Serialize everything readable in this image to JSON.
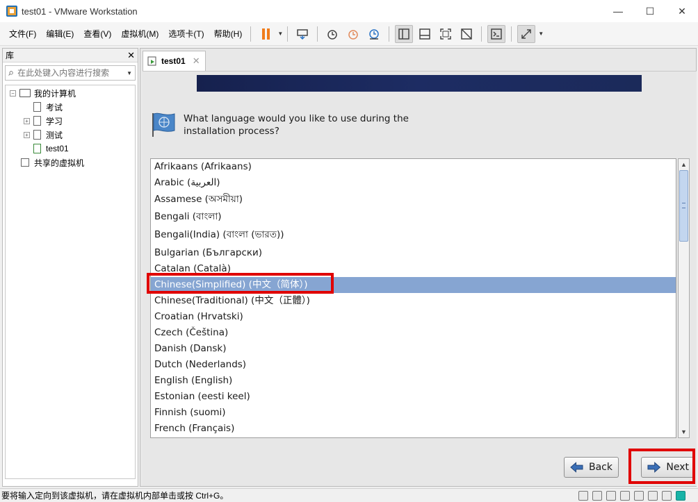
{
  "window": {
    "title": "test01 - VMware Workstation",
    "minimize": "—",
    "maximize": "☐",
    "close": "✕"
  },
  "menu": {
    "items": [
      "文件(F)",
      "编辑(E)",
      "查看(V)",
      "虚拟机(M)",
      "选项卡(T)",
      "帮助(H)"
    ]
  },
  "library": {
    "title": "库",
    "close": "✕",
    "search_placeholder": "在此处键入内容进行搜索",
    "tree": {
      "root": "我的计算机",
      "items": [
        "考试",
        "学习",
        "测试",
        "test01"
      ],
      "shared": "共享的虚拟机"
    }
  },
  "tab": {
    "title": "test01",
    "close": "✕"
  },
  "installer": {
    "question_line1": "What language would you like to use during the",
    "question_line2": "installation process?",
    "languages": [
      "Afrikaans (Afrikaans)",
      "Arabic (العربية)",
      "Assamese (অসমীয়া)",
      "Bengali (বাংলা)",
      "Bengali(India) (বাংলা (ভারত))",
      "Bulgarian (Български)",
      "Catalan (Català)",
      "Chinese(Simplified) (中文（简体）)",
      "Chinese(Traditional) (中文（正體）)",
      "Croatian (Hrvatski)",
      "Czech (Čeština)",
      "Danish (Dansk)",
      "Dutch (Nederlands)",
      "English (English)",
      "Estonian (eesti keel)",
      "Finnish (suomi)",
      "French (Français)"
    ],
    "selected_language": "Chinese(Simplified) (中文（简体）)",
    "back_label": "Back",
    "next_label": "Next"
  },
  "statusbar": {
    "text": "要将输入定向到该虚拟机，请在虚拟机内部单击或按 Ctrl+G。"
  },
  "colors": {
    "selection": "#86a5d2",
    "highlight": "#e00000",
    "banner": "#1b2a5a",
    "pause": "#f07c1b"
  }
}
